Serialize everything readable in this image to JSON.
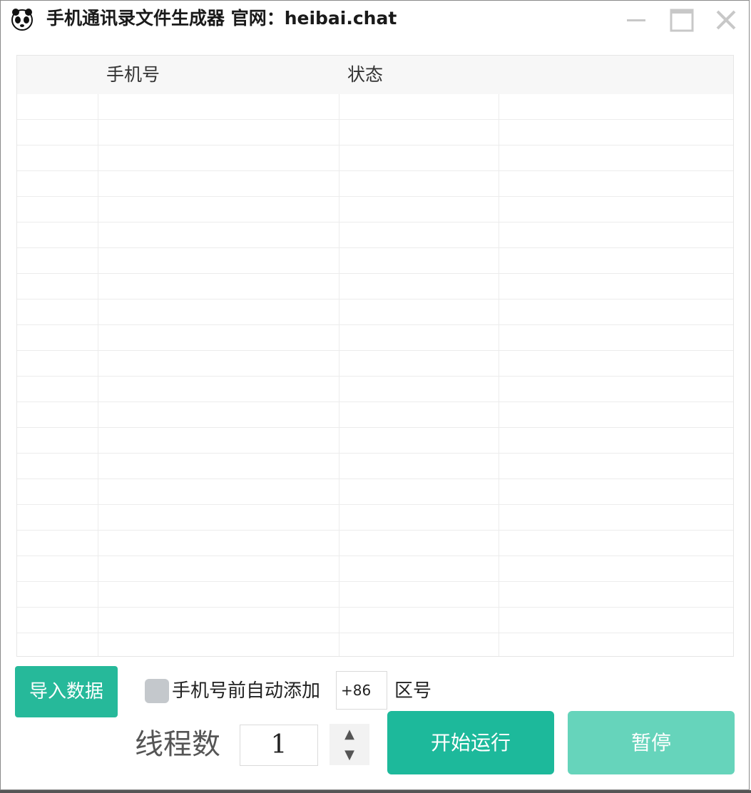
{
  "window": {
    "title": "手机通讯录文件生成器 官网：heibai.chat",
    "icon": "panda-icon"
  },
  "table": {
    "columns": [
      "",
      "手机号",
      "状态",
      ""
    ],
    "row_count": 22
  },
  "controls": {
    "import_label": "导入数据",
    "auto_prefix_label": "手机号前自动添加",
    "auto_prefix_checked": false,
    "prefix_value": "+86",
    "area_code_label": "区号",
    "thread_label": "线程数",
    "thread_value": "1",
    "start_label": "开始运行",
    "pause_label": "暂停"
  },
  "colors": {
    "accent": "#1db99b",
    "accent_disabled": "#66d4bb",
    "checkbox": "#c4c8cc"
  }
}
